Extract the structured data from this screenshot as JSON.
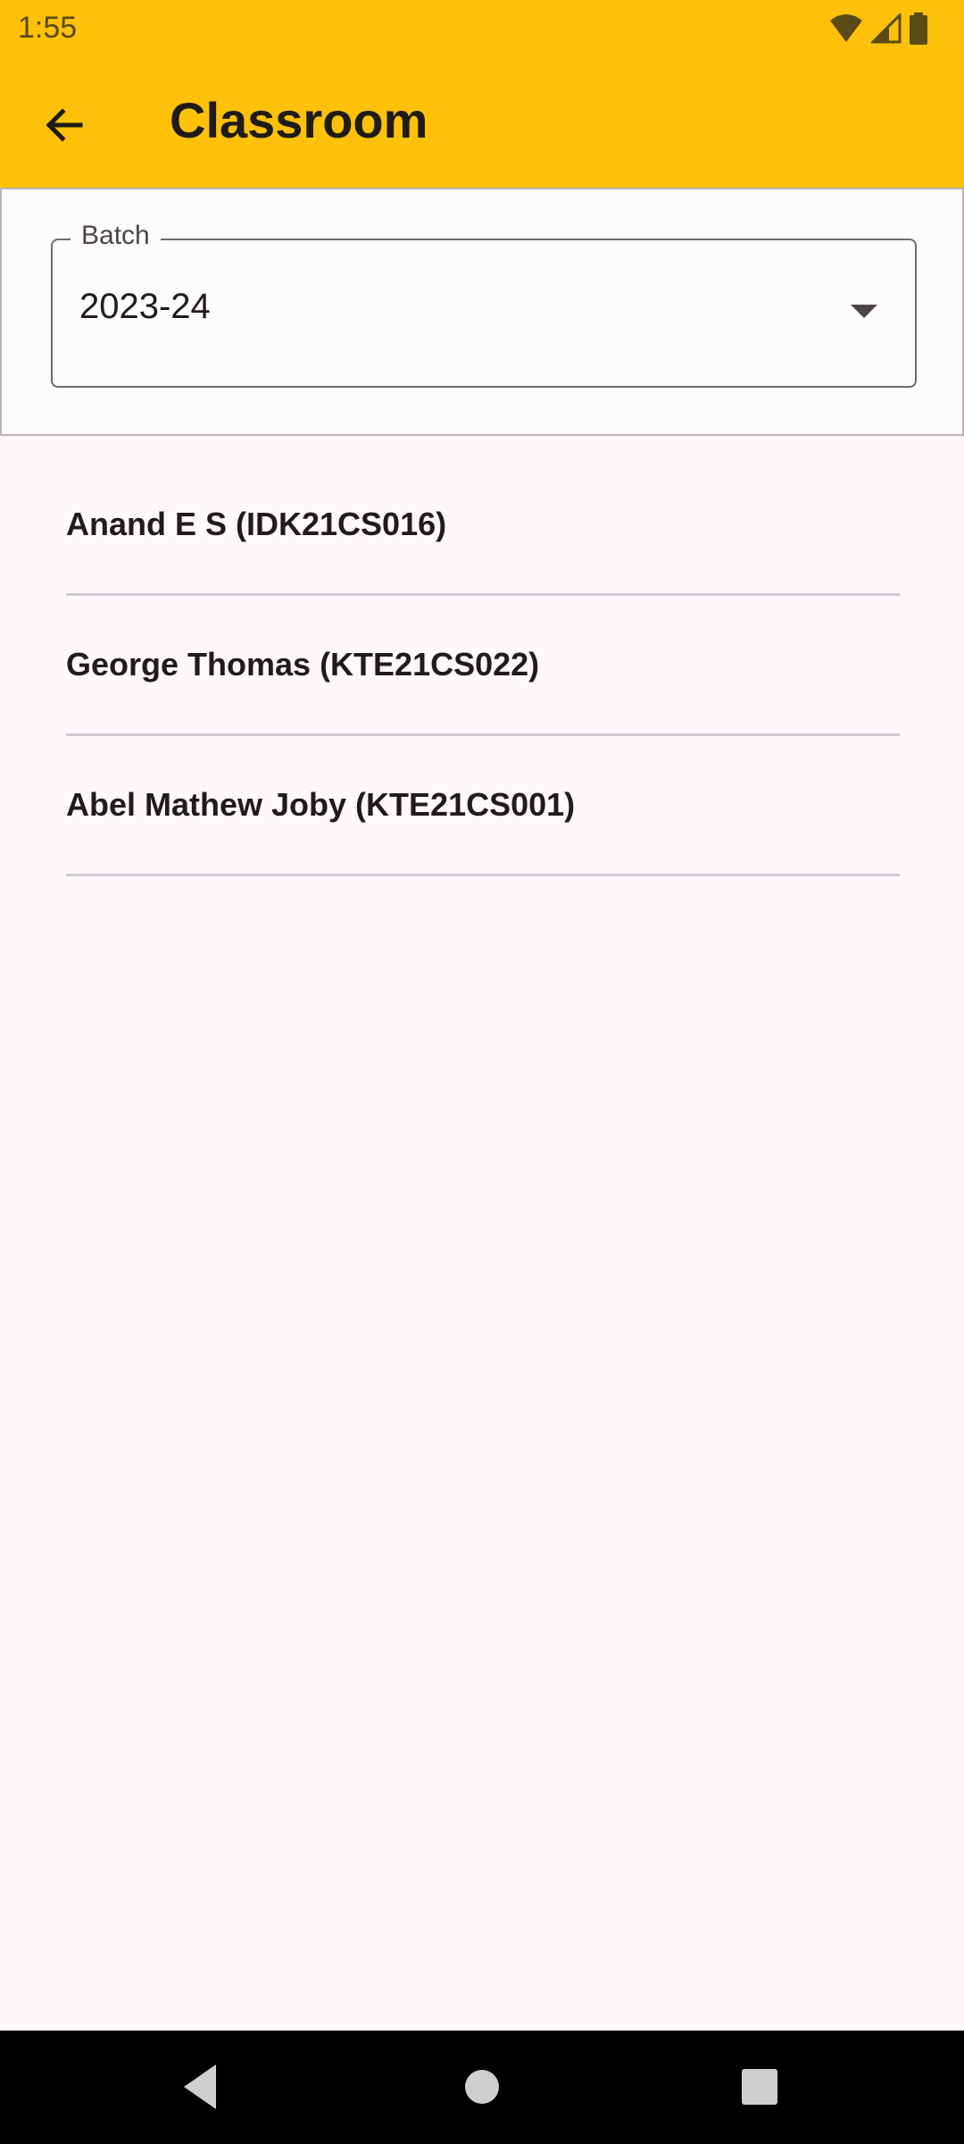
{
  "status_bar": {
    "time": "1:55",
    "icons": [
      "wifi-icon",
      "cell-signal-icon",
      "battery-icon"
    ]
  },
  "toolbar": {
    "title": "Classroom",
    "back_icon": "arrow-back-icon"
  },
  "batch_selector": {
    "label": "Batch",
    "value": "2023-24"
  },
  "students": [
    {
      "label": "Anand E S (IDK21CS016)"
    },
    {
      "label": "George Thomas (KTE21CS022)"
    },
    {
      "label": "Abel Mathew Joby (KTE21CS001)"
    }
  ],
  "colors": {
    "app_bar": "#fec10a",
    "background": "#fdf8fc",
    "text": "#1f1b1f",
    "divider": "#cfcacf"
  },
  "nav_bar": {
    "icons": [
      "nav-back-icon",
      "nav-home-icon",
      "nav-recents-icon"
    ]
  }
}
